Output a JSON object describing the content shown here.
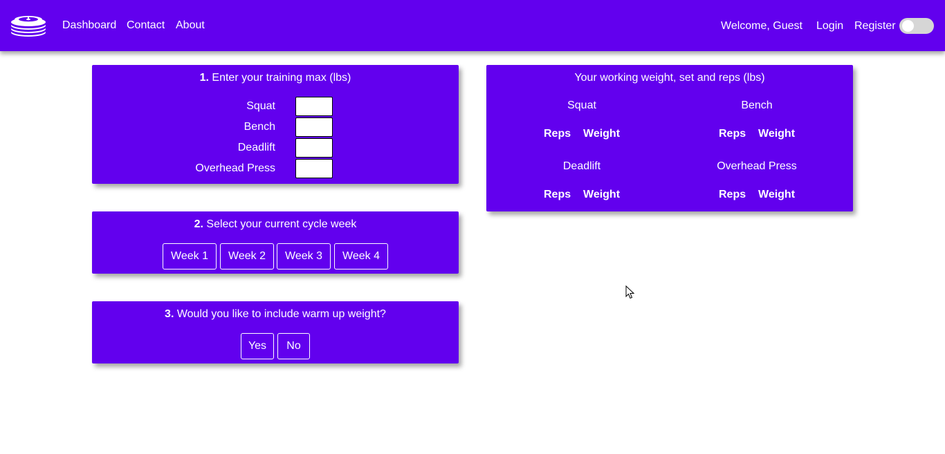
{
  "navbar": {
    "links": [
      "Dashboard",
      "Contact",
      "About"
    ],
    "welcome": "Welcome, Guest",
    "login": "Login",
    "register": "Register",
    "theme_toggle_on": false,
    "background": "#6200ee"
  },
  "step1": {
    "number": "1.",
    "title": "Enter your training max (lbs)",
    "lifts": [
      {
        "label": "Squat",
        "value": ""
      },
      {
        "label": "Bench",
        "value": ""
      },
      {
        "label": "Deadlift",
        "value": ""
      },
      {
        "label": "Overhead Press",
        "value": ""
      }
    ]
  },
  "step2": {
    "number": "2.",
    "title": "Select your current cycle week",
    "weeks": [
      "Week 1",
      "Week 2",
      "Week 3",
      "Week 4"
    ]
  },
  "step3": {
    "number": "3.",
    "title": "Would you like to include warm up weight?",
    "yes": "Yes",
    "no": "No"
  },
  "results": {
    "title": "Your working weight, set and reps (lbs)",
    "lifts": [
      {
        "name": "Squat",
        "reps": "Reps",
        "weight": "Weight"
      },
      {
        "name": "Bench",
        "reps": "Reps",
        "weight": "Weight"
      },
      {
        "name": "Deadlift",
        "reps": "Reps",
        "weight": "Weight"
      },
      {
        "name": "Overhead Press",
        "reps": "Reps",
        "weight": "Weight"
      }
    ]
  },
  "theme": {
    "primary": "#6200ee",
    "text": "#ffffff"
  }
}
